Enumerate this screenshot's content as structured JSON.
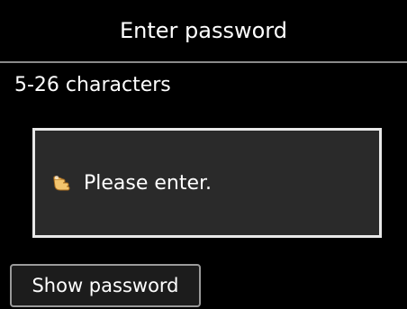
{
  "header": {
    "title": "Enter password"
  },
  "content": {
    "hint": "5-26 characters",
    "input": {
      "placeholder": "Please enter.",
      "icon": "pointing-hand-icon"
    }
  },
  "footer": {
    "show_password_label": "Show password"
  },
  "colors": {
    "background": "#000000",
    "text": "#ffffff",
    "input_border": "#e8e8e8",
    "input_fill": "#2a2a2a",
    "hand_icon": "#f2c46d"
  }
}
